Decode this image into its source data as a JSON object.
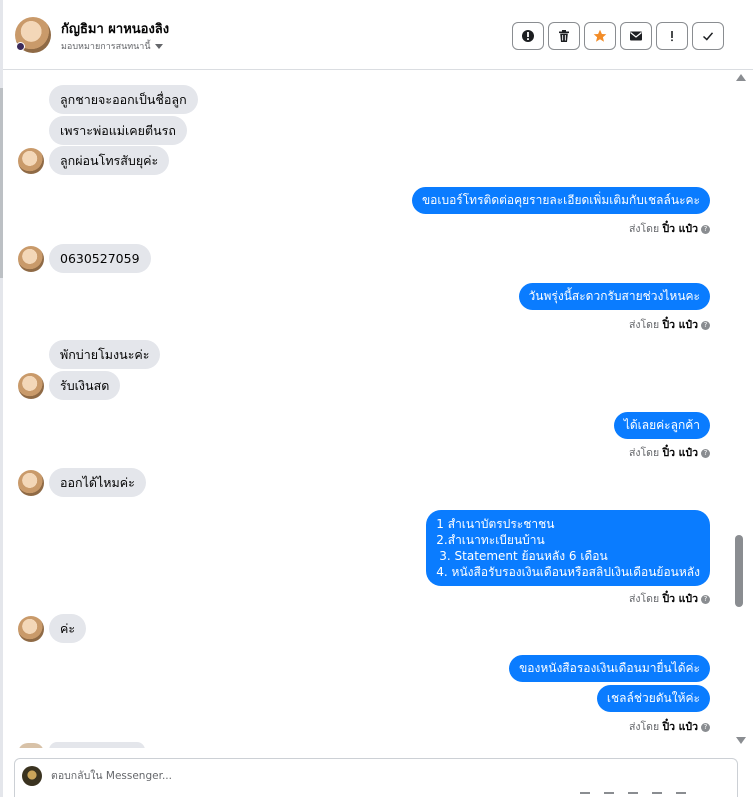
{
  "header": {
    "contact_name": "กัญธิมา ผาหนองลิง",
    "contact_subtitle": "มอบหมายการสนทนานี้",
    "tools": [
      {
        "name": "mark-spam",
        "icon": "alert-circle-icon"
      },
      {
        "name": "delete",
        "icon": "trash-icon"
      },
      {
        "name": "star",
        "icon": "star-icon"
      },
      {
        "name": "mark-unread",
        "icon": "envelope-icon"
      },
      {
        "name": "follow-up",
        "icon": "exclamation-icon"
      },
      {
        "name": "mark-done",
        "icon": "check-icon"
      }
    ]
  },
  "messages": {
    "in_1": "ลูกชายจะออกเป็นชื่อลูก",
    "in_2": "เพราะพ่อแม่เคยตีนรถ",
    "in_3": "ลูกผ่อนโทรสับยุค่ะ",
    "out_1": "ขอเบอร์โทรติดต่อคุยรายละเอียดเพิ่มเติมกับเชลล์นะคะ",
    "in_4": "0630527059",
    "out_2": "วันพรุ่งนี้สะดวกรับสายช่วงไหนคะ",
    "in_5": "พักบ่ายโมงนะค่ะ",
    "in_6": "รับเงินสด",
    "out_3": "ได้เลยค่ะลูกค้า",
    "in_7": "ออกได้ไหมค่ะ",
    "out_4_lines": [
      "1 สำเนาบัตรประชาชน",
      "2.สำเนาทะเบียนบ้าน",
      "3. Statement ย้อนหลัง 6 เดือน",
      "4. หนังสือรับรองเงินเดือนหรือสลิปเงินเดือนย้อนหลัง"
    ],
    "in_8": "ค่ะ",
    "out_5": "ของหนังสือรองเงินเดือนมายื่นได้ค่ะ",
    "out_6": "เชลล์ช่วยดันให้ค่ะ"
  },
  "sent_by": {
    "prefix": "ส่งโดย",
    "name": "ปิ๋ว แป๋ว",
    "info_icon": "?"
  },
  "composer": {
    "placeholder": "ตอบกลับใน Messenger..."
  },
  "colors": {
    "outgoing_bubble": "#0a7cff",
    "incoming_bubble": "#e4e6eb",
    "star": "#f28c28"
  }
}
